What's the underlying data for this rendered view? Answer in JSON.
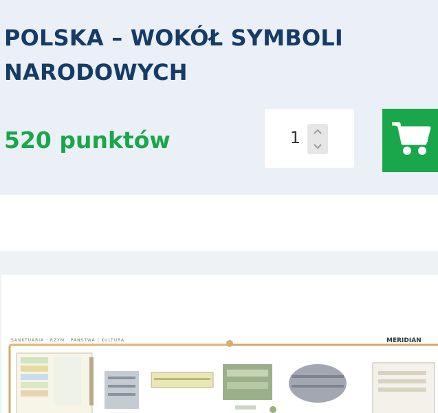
{
  "product": {
    "title": "POLSKA – WOKÓŁ SYMBOLI NARODOWYCH",
    "price": "520 punktów",
    "quantity": "1",
    "quantity_stepper_icons": [
      "chevron-up-icon",
      "chevron-down-icon"
    ],
    "cart_icon": "shopping-cart-icon"
  },
  "preview": {
    "header_text": "SANKTUARIA · RZYM · PANSTWA I KULTURA",
    "brand": "MERIDIAN"
  },
  "colors": {
    "title": "#163b66",
    "price": "#1aa64a",
    "cart_button": "#1aa64a",
    "panel_background": "#eaf0f6"
  }
}
